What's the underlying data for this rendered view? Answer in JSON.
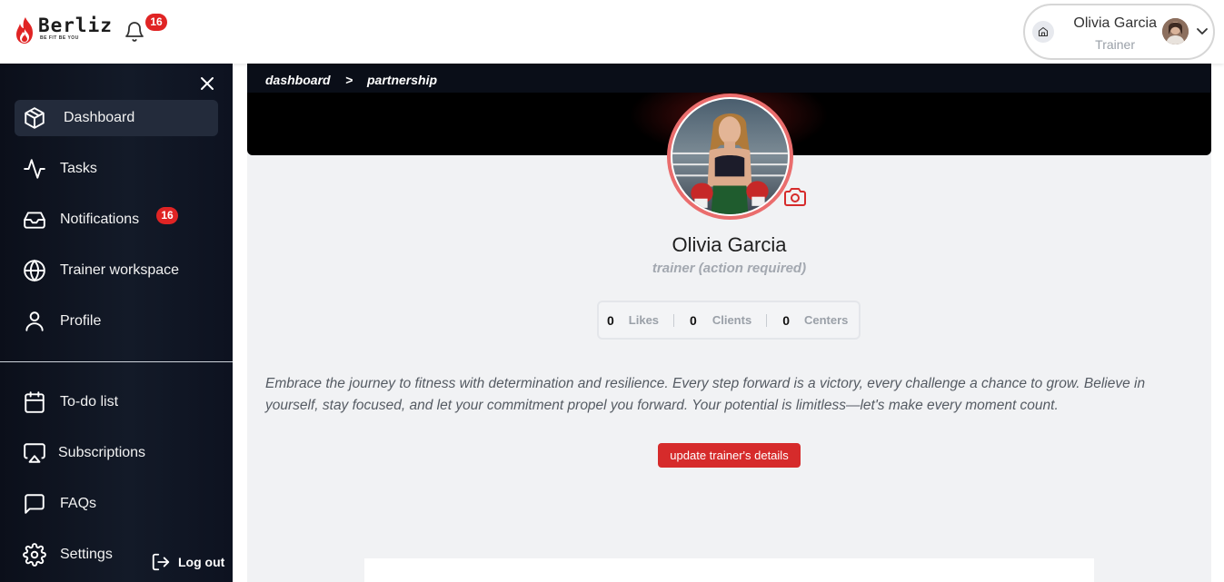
{
  "header": {
    "brand": "Berliz",
    "brand_tagline": "BE FIT BE YOU",
    "notification_count": "16",
    "user": {
      "name": "Olivia Garcia",
      "role": "Trainer"
    }
  },
  "sidebar": {
    "items": [
      {
        "label": "Dashboard",
        "icon": "cube-icon",
        "active": true
      },
      {
        "label": "Tasks",
        "icon": "activity-icon"
      },
      {
        "label": "Notifications",
        "icon": "inbox-icon",
        "badge": "16"
      },
      {
        "label": "Trainer workspace",
        "icon": "globe-icon"
      },
      {
        "label": "Profile",
        "icon": "user-icon"
      },
      {
        "label": "To-do list",
        "icon": "calendar-icon"
      },
      {
        "label": "Subscriptions",
        "icon": "airplay-icon"
      },
      {
        "label": "FAQs",
        "icon": "message-square-icon"
      },
      {
        "label": "Settings",
        "icon": "gear-icon"
      }
    ],
    "logout_label": "Log out"
  },
  "breadcrumb": {
    "items": [
      "dashboard",
      "partnership"
    ],
    "separator": ">"
  },
  "profile": {
    "name": "Olivia Garcia",
    "status": "trainer (action required)",
    "stats": [
      {
        "value": "0",
        "label": "Likes"
      },
      {
        "value": "0",
        "label": "Clients"
      },
      {
        "value": "0",
        "label": "Centers"
      }
    ],
    "bio": "Embrace the journey to fitness with determination and resilience. Every step forward is a victory, every challenge a chance to grow. Believe in yourself, stay focused, and let your commitment propel you forward. Your potential is limitless—let's make every moment count.",
    "update_button_label": "update trainer's details"
  },
  "colors": {
    "accent": "#d62b2b",
    "badge": "#e02424",
    "sidebar_bg": "#0b0f1a",
    "avatar_ring": "#ea6d6d"
  }
}
